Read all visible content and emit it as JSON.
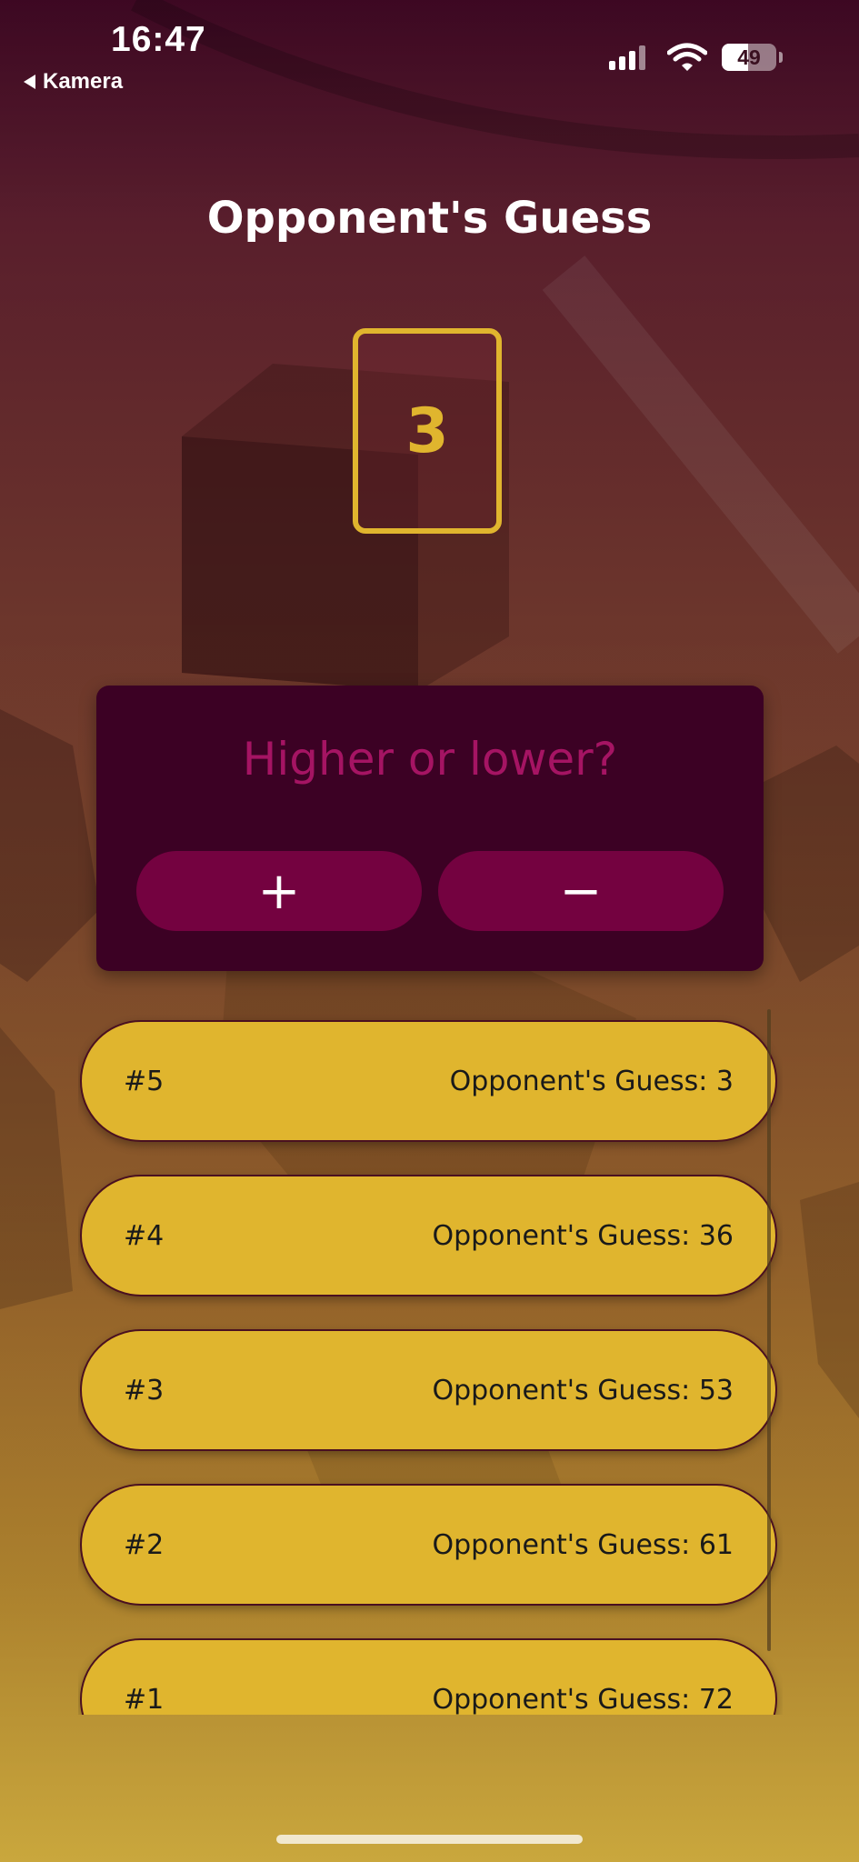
{
  "status_bar": {
    "time": "16:47",
    "back_label": "Kamera",
    "battery_percent": 49,
    "battery_text": "49",
    "signal_icon": "cellular-signal-icon",
    "wifi_icon": "wifi-icon"
  },
  "screen": {
    "title": "Opponent's Guess",
    "current_guess": "3"
  },
  "prompt": {
    "question": "Higher or lower?",
    "higher_label": "+",
    "lower_label": "−"
  },
  "history": [
    {
      "index": "#5",
      "text": "Opponent's Guess: 3"
    },
    {
      "index": "#4",
      "text": "Opponent's Guess: 36"
    },
    {
      "index": "#3",
      "text": "Opponent's Guess: 53"
    },
    {
      "index": "#2",
      "text": "Opponent's Guess: 61"
    },
    {
      "index": "#1",
      "text": "Opponent's Guess: 72"
    }
  ],
  "colors": {
    "accent_gold": "#e0b52e",
    "panel_dark": "#3c0124",
    "button_magenta": "#740240",
    "question_magenta": "#a51463"
  }
}
